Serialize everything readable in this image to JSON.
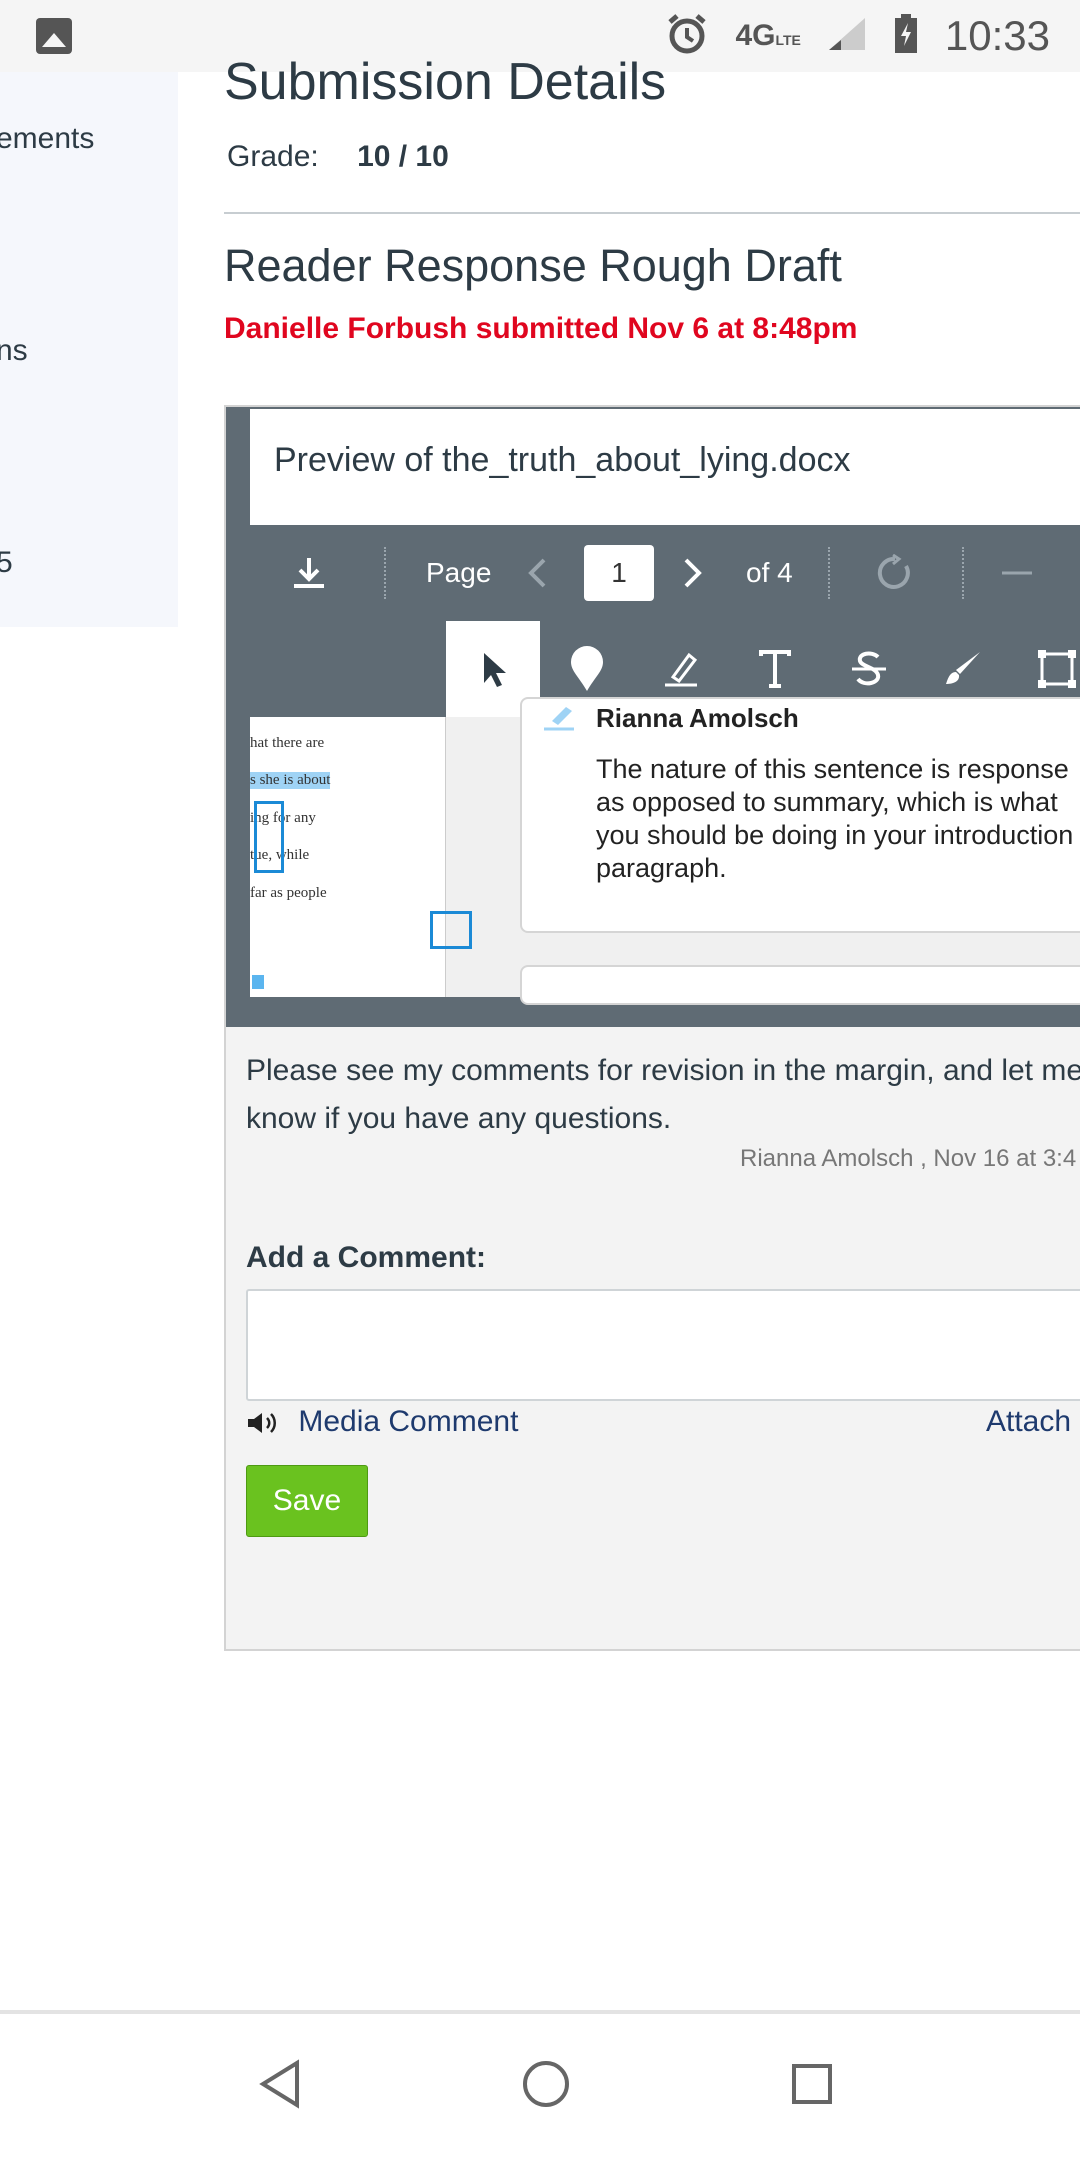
{
  "status_bar": {
    "network": "4G",
    "network_sub": "LTE",
    "time": "10:33"
  },
  "sidebar": {
    "items": [
      {
        "label": "ements"
      },
      {
        "label": "ns"
      },
      {
        "label": "5"
      }
    ]
  },
  "header": {
    "title": "Submission Details",
    "grade_label": "Grade:",
    "grade_value": "10 / 10"
  },
  "assignment": {
    "title": "Reader Response Rough Draft",
    "submitted_text": "Danielle Forbush submitted Nov 6 at 8:48pm"
  },
  "preview": {
    "title": "Preview of the_truth_about_lying.docx",
    "toolbar": {
      "page_label": "Page",
      "page_value": "1",
      "page_total": "of 4"
    },
    "document_lines": [
      "hat there are",
      "s she is about",
      "ing for any",
      "tue, while",
      "far as people"
    ],
    "annotation": {
      "author": "Rianna Amolsch",
      "text": "The nature of this sentence is response as opposed to summary, which is what you should be doing in your introduction paragraph."
    }
  },
  "comments": {
    "teacher_comment": "Please see my comments for revision in the margin, and let me know if you have any questions.",
    "meta": "Rianna Amolsch , Nov 16 at 3:4"
  },
  "add_comment": {
    "label": "Add a Comment:",
    "media_label": "Media Comment",
    "attach_label": "Attach",
    "save_label": "Save"
  },
  "colors": {
    "submitted_red": "#e0061f",
    "save_green": "#6ac21f",
    "toolbar_gray": "#5f6b74",
    "link_blue": "#1e3a6e"
  }
}
